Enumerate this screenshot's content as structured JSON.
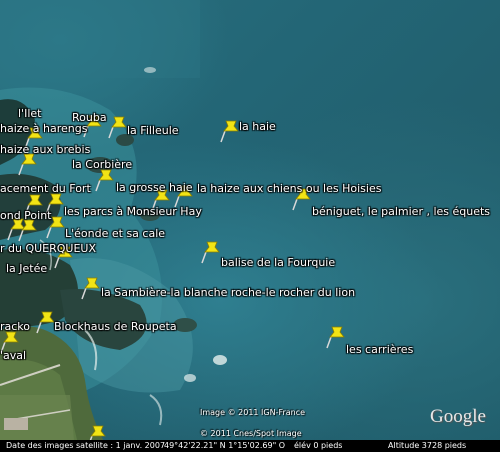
{
  "placemarks": [
    {
      "name": "l'Ilet",
      "pin": false
    },
    {
      "name": "Rouba",
      "pin": false
    },
    {
      "name": "haize à harengs",
      "pin": true
    },
    {
      "name": "la Filleule",
      "pin": true
    },
    {
      "name": "la haie",
      "pin": true
    },
    {
      "name": "haize aux brebis",
      "pin": true
    },
    {
      "name": "la Corbière",
      "pin": false
    },
    {
      "name": "acement du Fort",
      "pin": true
    },
    {
      "name": "la grosse haie",
      "pin": true
    },
    {
      "name": "la haize aux chiens ou les Hoisies",
      "pin": true
    },
    {
      "name": "béniguet, le palmier , les équets",
      "pin": true
    },
    {
      "name": "ond Point",
      "pin": true
    },
    {
      "name": "les parcs à Monsieur Hay",
      "pin": true
    },
    {
      "name": "L'éonde et sa cale",
      "pin": true
    },
    {
      "name": "r du QUERQUEUX",
      "pin": true
    },
    {
      "name": "balise de la Fourquie",
      "pin": true
    },
    {
      "name": "la Jetée",
      "pin": true
    },
    {
      "name": "la Sambière-la blanche roche-le rocher du lion",
      "pin": true
    },
    {
      "name": "racko",
      "pin": true
    },
    {
      "name": "Blockhaus de Roupeta",
      "pin": false
    },
    {
      "name": "les carrières",
      "pin": true
    },
    {
      "name": "'aval",
      "pin": true
    }
  ],
  "credits": {
    "ign": "Image © 2011 IGN-France",
    "cnes": "© 2011 Cnes/Spot Image"
  },
  "logo": "Google",
  "status": {
    "imagery_date": "Date des images satellite : 1 janv. 2007",
    "coordinates": "49°42'22.21\" N    1°15'02.69\" O",
    "elevation": "élév   0 pieds",
    "altitude": "Altitude    3728 pieds"
  },
  "colors": {
    "pin_yellow": "#f2e415",
    "label_text": "#ffffff",
    "sea": "#236676",
    "land_green": "#4f6a3c"
  }
}
